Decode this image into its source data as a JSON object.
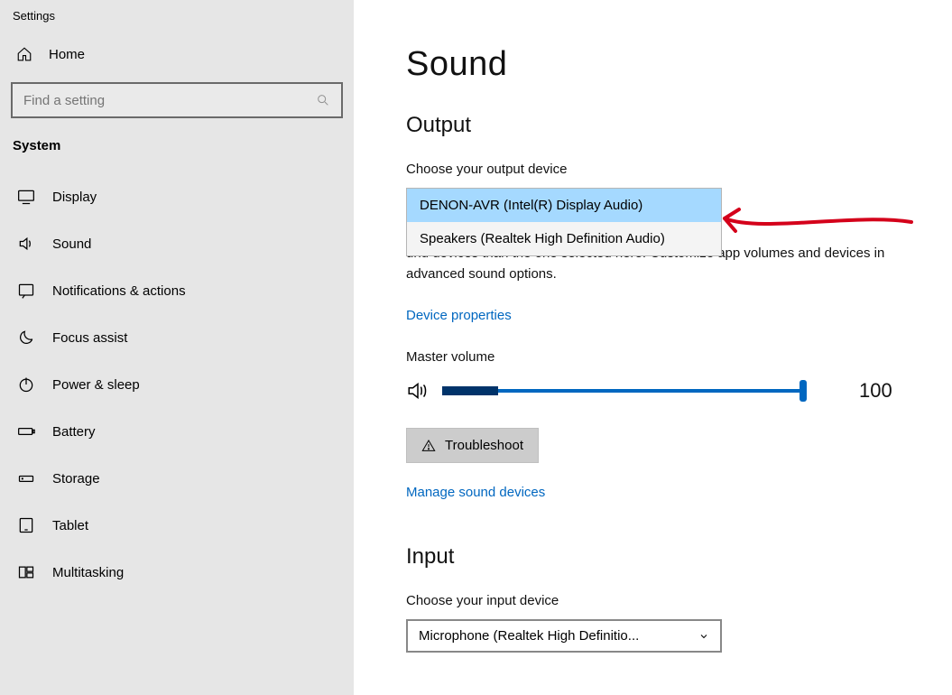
{
  "sidebar": {
    "app_title": "Settings",
    "home_label": "Home",
    "search_placeholder": "Find a setting",
    "group_label": "System",
    "items": [
      {
        "label": "Display"
      },
      {
        "label": "Sound"
      },
      {
        "label": "Notifications & actions"
      },
      {
        "label": "Focus assist"
      },
      {
        "label": "Power & sleep"
      },
      {
        "label": "Battery"
      },
      {
        "label": "Storage"
      },
      {
        "label": "Tablet"
      },
      {
        "label": "Multitasking"
      }
    ]
  },
  "main": {
    "title": "Sound",
    "output": {
      "heading": "Output",
      "choose_label": "Choose your output device",
      "options": [
        "DENON-AVR (Intel(R) Display Audio)",
        "Speakers (Realtek High Definition Audio)"
      ],
      "note_partial": "und devices than the one selected here. Customize app volumes and devices in advanced sound options.",
      "device_props_link": "Device properties",
      "master_volume_label": "Master volume",
      "master_volume_value": "100",
      "troubleshoot_label": "Troubleshoot",
      "manage_link": "Manage sound devices"
    },
    "input": {
      "heading": "Input",
      "choose_label": "Choose your input device",
      "selected": "Microphone (Realtek High Definitio..."
    }
  }
}
